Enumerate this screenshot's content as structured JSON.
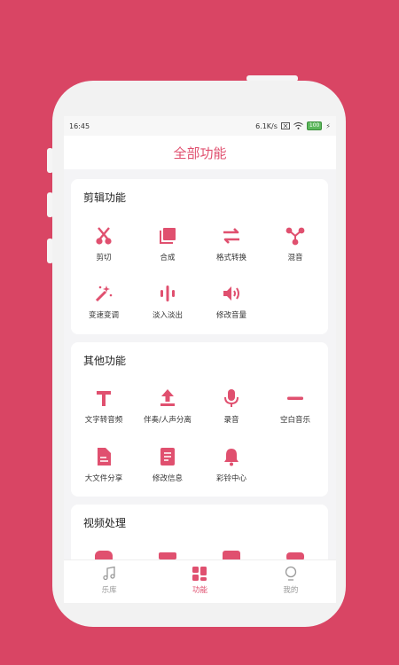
{
  "status_bar": {
    "time": "16:45",
    "network_speed": "6.1K/s",
    "battery": "100"
  },
  "header": {
    "title": "全部功能"
  },
  "sections": {
    "edit": {
      "title": "剪辑功能",
      "items": [
        {
          "label": "剪切",
          "icon": "scissors-icon"
        },
        {
          "label": "合成",
          "icon": "merge-icon"
        },
        {
          "label": "格式转换",
          "icon": "convert-arrows-icon"
        },
        {
          "label": "混音",
          "icon": "mix-icon"
        },
        {
          "label": "变速变调",
          "icon": "magic-wand-icon"
        },
        {
          "label": "淡入淡出",
          "icon": "waveform-icon"
        },
        {
          "label": "修改音量",
          "icon": "speaker-icon"
        }
      ]
    },
    "other": {
      "title": "其他功能",
      "items": [
        {
          "label": "文字转音频",
          "icon": "text-icon"
        },
        {
          "label": "伴奏/人声分离",
          "icon": "upload-icon"
        },
        {
          "label": "录音",
          "icon": "microphone-icon"
        },
        {
          "label": "空白音乐",
          "icon": "minus-icon"
        },
        {
          "label": "大文件分享",
          "icon": "file-icon"
        },
        {
          "label": "修改信息",
          "icon": "document-icon"
        },
        {
          "label": "彩铃中心",
          "icon": "bell-icon"
        }
      ]
    },
    "video": {
      "title": "视频处理"
    }
  },
  "tabbar": {
    "library": "乐库",
    "functions": "功能",
    "mine": "我的"
  },
  "colors": {
    "accent": "#e0506f",
    "background": "#d94564"
  }
}
